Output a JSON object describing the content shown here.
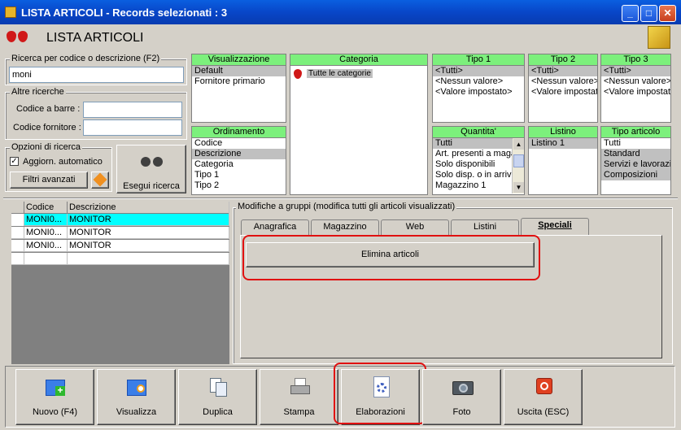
{
  "window": {
    "title": "LISTA ARTICOLI - Records selezionati : 3"
  },
  "header": {
    "title": "LISTA ARTICOLI"
  },
  "search": {
    "group_label": "Ricerca per codice o descrizione (F2)",
    "value": "moni",
    "other_label": "Altre ricerche",
    "barcode_label": "Codice a barre :",
    "barcode_value": "",
    "supplier_code_label": "Codice fornitore :",
    "supplier_code_value": "",
    "options_label": "Opzioni di ricerca",
    "auto_update_label": "Aggiorn. automatico",
    "auto_update_checked": true,
    "advanced_filters_label": "Filtri avanzati",
    "run_search_label": "Esegui ricerca"
  },
  "filters": {
    "visualizzazione": {
      "header": "Visualizzazione",
      "items": [
        "Default",
        "Fornitore primario"
      ],
      "selected": 0
    },
    "ordinamento": {
      "header": "Ordinamento",
      "items": [
        "Codice",
        "Descrizione",
        "Categoria",
        "Tipo 1",
        "Tipo 2"
      ],
      "selected": 1
    },
    "categoria": {
      "header": "Categoria",
      "items": [
        "Tutte le categorie"
      ]
    },
    "tipo1": {
      "header": "Tipo 1",
      "items": [
        "<Tutti>",
        "<Nessun valore>",
        "<Valore impostato>"
      ],
      "selected": 0
    },
    "tipo2": {
      "header": "Tipo 2",
      "items": [
        "<Tutti>",
        "<Nessun valore>",
        "<Valore impostato>"
      ],
      "selected": 0
    },
    "tipo3": {
      "header": "Tipo 3",
      "items": [
        "<Tutti>",
        "<Nessun valore>",
        "<Valore impostato>"
      ],
      "selected": 0
    },
    "quantita": {
      "header": "Quantita'",
      "items": [
        "Tutti",
        "Art. presenti a magazzino",
        "Solo disponibili",
        "Solo disp. o in arrivo",
        "Magazzino 1"
      ],
      "selected": 0
    },
    "listino": {
      "header": "Listino",
      "items": [
        "Listino 1"
      ],
      "selected": 0
    },
    "tipo_articolo": {
      "header": "Tipo articolo",
      "items": [
        "Tutti",
        "Standard",
        "Servizi e lavorazioni",
        "Composizioni"
      ],
      "selected_many": [
        1,
        2,
        3
      ]
    }
  },
  "grid": {
    "columns": [
      "Codice",
      "Descrizione"
    ],
    "rows": [
      {
        "codice": "MONI0...",
        "descrizione": "MONITOR"
      },
      {
        "codice": "MONI0...",
        "descrizione": "MONITOR"
      },
      {
        "codice": "MONI0...",
        "descrizione": "MONITOR"
      }
    ]
  },
  "group_edit": {
    "label": "Modifiche a gruppi (modifica tutti gli articoli visualizzati)",
    "tabs": [
      "Anagrafica",
      "Magazzino",
      "Web",
      "Listini",
      "Speciali"
    ],
    "active_tab": 4,
    "delete_button_label": "Elimina articoli"
  },
  "toolbar": {
    "buttons": [
      {
        "label": "Nuovo (F4)",
        "icon": "new-folder-icon"
      },
      {
        "label": "Visualizza",
        "icon": "view-folder-icon"
      },
      {
        "label": "Duplica",
        "icon": "duplicate-icon"
      },
      {
        "label": "Stampa",
        "icon": "printer-icon"
      },
      {
        "label": "Elaborazioni",
        "icon": "processing-gear-icon"
      },
      {
        "label": "Foto",
        "icon": "camera-icon"
      },
      {
        "label": "Uscita (ESC)",
        "icon": "exit-icon"
      }
    ]
  },
  "colors": {
    "accent_green": "#7cf07c",
    "selection_cyan": "#00ffff",
    "highlight_red": "#e01010",
    "title_blue": "#0846c8"
  }
}
